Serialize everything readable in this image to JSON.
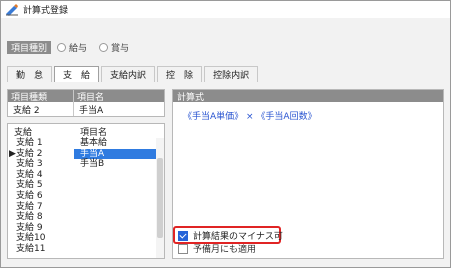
{
  "window": {
    "title": "計算式登録",
    "icon": "app-icon"
  },
  "item_kind": {
    "label": "項目種別",
    "options": [
      {
        "label": "給与",
        "selected": false
      },
      {
        "label": "賞与",
        "selected": false
      }
    ]
  },
  "tabs": [
    "勤　怠",
    "支　給",
    "支給内訳",
    "控　除",
    "控除内訳"
  ],
  "active_tab": "支　給",
  "selected_item_grid": {
    "headers": [
      "項目種類",
      "項目名"
    ],
    "row": [
      "支給 2",
      "手当A"
    ]
  },
  "item_list": {
    "headers": [
      "支給",
      "項目名"
    ],
    "rows": [
      [
        "支給 1",
        "基本給"
      ],
      [
        "▶支給 2",
        "手当A"
      ],
      [
        "支給 3",
        "手当B"
      ],
      [
        "支給 4",
        ""
      ],
      [
        "支給 5",
        ""
      ],
      [
        "支給 6",
        ""
      ],
      [
        "支給 7",
        ""
      ],
      [
        "支給 8",
        ""
      ],
      [
        "支給 9",
        ""
      ],
      [
        "支給10",
        ""
      ],
      [
        "支給11",
        ""
      ]
    ],
    "selected_index": 1
  },
  "formula": {
    "header": "計算式",
    "text": "《手当A単価》 × 《手当A回数》"
  },
  "options": {
    "minus_allowed": {
      "label": "計算結果のマイナス可",
      "checked": true
    },
    "next_month": {
      "label": "予備月にも適用",
      "checked": false
    }
  },
  "colors": {
    "highlight": "#e02424",
    "selection": "#2f7be0",
    "formula_text": "#2a55d1"
  }
}
